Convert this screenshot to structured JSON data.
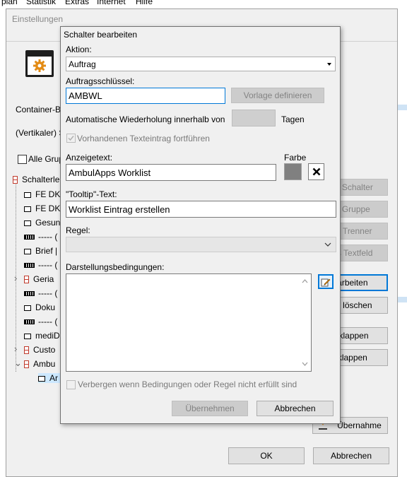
{
  "menu": {
    "items": [
      "plan",
      "Statistik",
      "Extras",
      "Internet",
      "Hilfe"
    ]
  },
  "settings_window": {
    "title": "Einstellungen",
    "container_label": "Container-Bi",
    "vertical_label": "(Vertikaler) S",
    "all_groups_label": "Alle Grup",
    "tree_root_label": "Schalterle",
    "tree_items": [
      {
        "label": "FE DK",
        "icon": "node-icon"
      },
      {
        "label": "FE DK",
        "icon": "node-icon"
      },
      {
        "label": "Gesun",
        "icon": "node-icon"
      },
      {
        "label": "----- (",
        "icon": "separator-icon"
      },
      {
        "label": "Brief |",
        "icon": "node-icon"
      },
      {
        "label": "----- (",
        "icon": "separator-icon"
      },
      {
        "label": "Geria",
        "icon": "group-icon"
      },
      {
        "label": "----- (",
        "icon": "separator-icon"
      },
      {
        "label": "Doku",
        "icon": "node-icon"
      },
      {
        "label": "----- (",
        "icon": "separator-icon"
      },
      {
        "label": "mediD",
        "icon": "node-icon"
      },
      {
        "label": "Custo",
        "icon": "group-icon"
      },
      {
        "label": "Ambu",
        "icon": "group-icon"
      },
      {
        "label": "Ar",
        "icon": "node-icon"
      }
    ],
    "side_buttons": {
      "new_switch": "uer Schalter",
      "new_group": "ue Gruppe",
      "new_separator": "uer Trenner",
      "new_textfield": "ues Textfeld",
      "edit": "earbeiten",
      "delete_entry": "rag löschen",
      "expand": "ufklappen",
      "collapse": "uklappen",
      "import": "Übernahme"
    },
    "ok_label": "OK",
    "cancel_label": "Abbrechen"
  },
  "dialog": {
    "title": "Schalter bearbeiten",
    "action_label": "Aktion:",
    "action_value": "Auftrag",
    "order_key_label": "Auftragsschlüssel:",
    "order_key_value": "AMBWL",
    "define_template_button": "Vorlage definieren",
    "repeat_label": "Automatische Wiederholung innerhalb von",
    "repeat_value": "",
    "days_label": "Tagen",
    "continue_text_label": "Vorhandenen Texteintrag fortführen",
    "display_text_label": "Anzeigetext:",
    "display_text_value": "AmbulApps Worklist",
    "color_label": "Farbe",
    "color_value": "#808080",
    "tooltip_label": "\"Tooltip\"-Text:",
    "tooltip_value": "Worklist Eintrag erstellen",
    "rule_label": "Regel:",
    "rule_value": "",
    "conditions_label": "Darstellungsbedingungen:",
    "hide_label": "Verbergen wenn Bedingungen oder Regel nicht erfüllt sind",
    "apply_button": "Übernehmen",
    "cancel_button": "Abbrechen"
  }
}
